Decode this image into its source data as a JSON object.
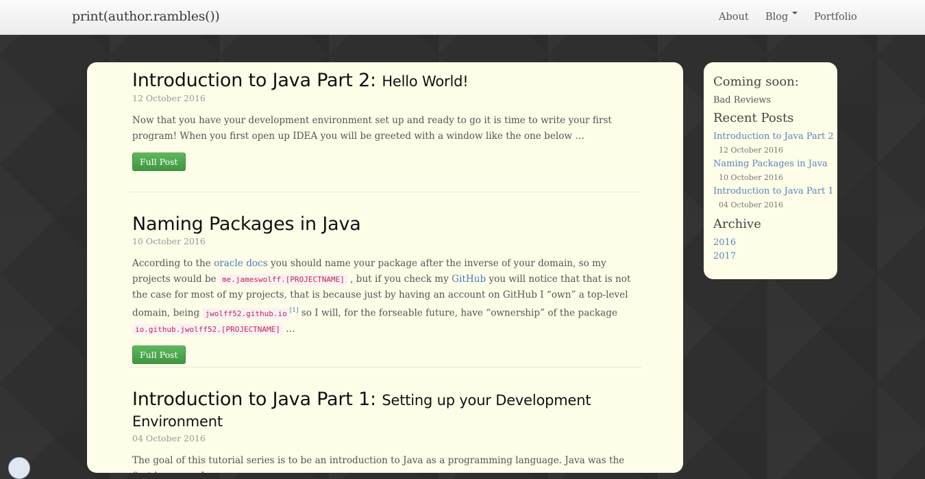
{
  "nav": {
    "brand": "print(author.rambles())",
    "about": "About",
    "blog": "Blog",
    "portfolio": "Portfolio"
  },
  "posts": [
    {
      "title_main": "Introduction to Java Part 2:",
      "title_sub": "Hello World!",
      "date": "12 October 2016",
      "excerpt": "Now that you have your development environment set up and ready to go it is time to write your first program! When you first open up IDEA you will be greeted with a window like the one below …",
      "button": "Full Post"
    },
    {
      "title_main": "Naming Packages in Java",
      "date": "10 October 2016",
      "excerpt": {
        "t1": "According to the ",
        "link1": "oracle docs",
        "t2": " you should name your package after the inverse of your domain, so my projects would be ",
        "code1": "me.jameswolff.[PROJECTNAME]",
        "t3": " , but if you check my ",
        "link2": "GitHub",
        "t4": " you will notice that that is not the case for most of my projects, that is because just by having an account on GitHub I “own” a top-level domain, being ",
        "code2": "jwolff52.github.io",
        "footnote": "[1]",
        "t5": " so I will, for the forseable future, have “ownership” of the package ",
        "code3": "io.github.jwolff52.[PROJECTNAME]",
        "t6": " …"
      },
      "button": "Full Post"
    },
    {
      "title_main": "Introduction to Java Part 1:",
      "title_sub": "Setting up your Development Environment",
      "date": "04 October 2016",
      "excerpt": "The goal of this tutorial series is to be an introduction to Java as a programming language. Java was the first language I"
    }
  ],
  "sidebar": {
    "coming_soon_heading": "Coming soon:",
    "coming_soon_item": "Bad Reviews",
    "recent_heading": "Recent Posts",
    "recent": [
      {
        "title": "Introduction to Java Part 2",
        "date": "12 October 2016"
      },
      {
        "title": "Naming Packages in Java",
        "date": "10 October 2016"
      },
      {
        "title": "Introduction to Java Part 1",
        "date": "04 October 2016"
      }
    ],
    "archive_heading": "Archive",
    "archive": [
      "2016",
      "2017"
    ]
  },
  "colors": {
    "card_bg": "#fdfde8",
    "page_bg": "#2f2f2f",
    "link": "#4a7cb8",
    "button": "#5cb85c",
    "code": "#c7254e"
  }
}
